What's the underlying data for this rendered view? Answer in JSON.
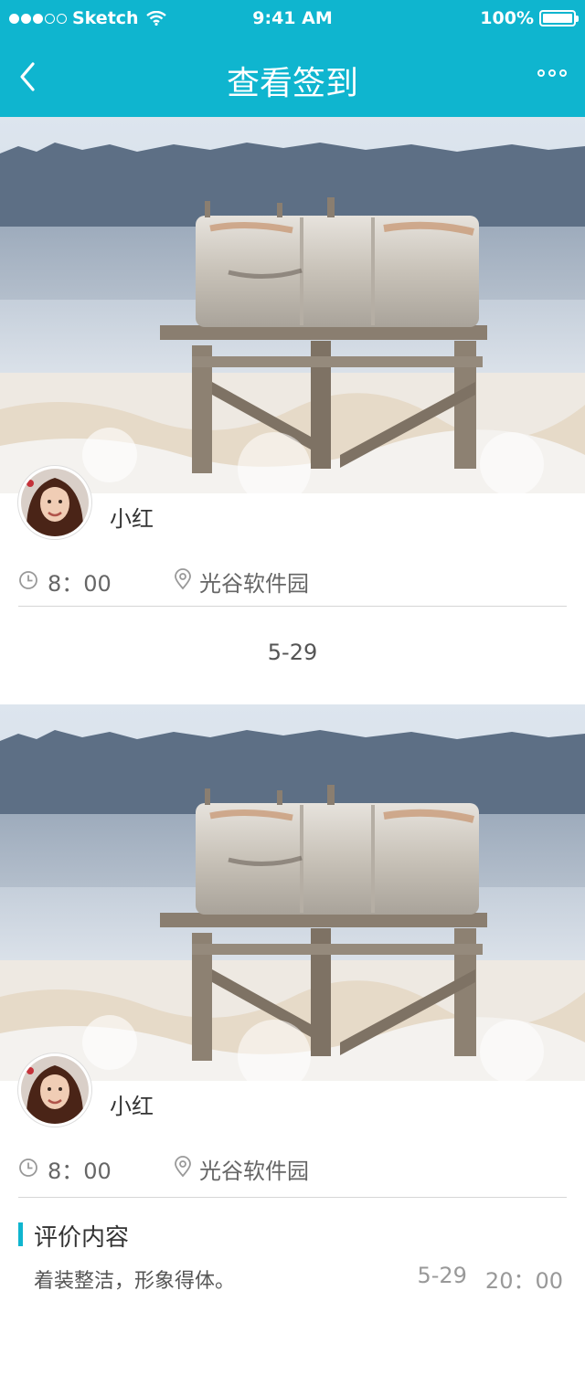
{
  "status": {
    "carrier": "Sketch",
    "time": "9:41 AM",
    "battery": "100%"
  },
  "nav": {
    "title": "查看签到",
    "back_icon": "chevron-left-icon",
    "more_icon": "more-dots-icon"
  },
  "checkins": [
    {
      "name": "小红",
      "time": "8：00",
      "location": "光谷软件园"
    },
    {
      "name": "小红",
      "time": "8：00",
      "location": "光谷软件园"
    }
  ],
  "date_separator": "5-29",
  "review": {
    "title": "评价内容",
    "content": "着装整洁，形象得体。",
    "date": "5-29",
    "time": "20：00"
  },
  "colors": {
    "accent": "#0fb5cf",
    "divider": "#d6d6d6"
  }
}
